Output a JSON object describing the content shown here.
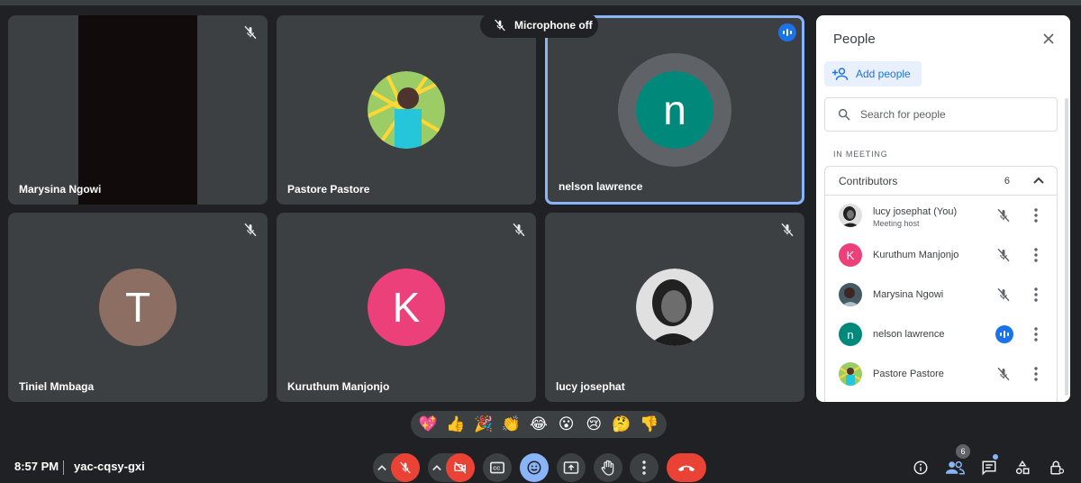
{
  "toast": {
    "text": "Microphone off"
  },
  "tiles": [
    {
      "name": "Marysina Ngowi",
      "type": "video"
    },
    {
      "name": "Pastore Pastore",
      "type": "photo"
    },
    {
      "name": "nelson lawrence",
      "type": "letter",
      "letter": "n",
      "color": "#00897b",
      "speaking": true
    },
    {
      "name": "Tiniel Mmbaga",
      "type": "letter",
      "letter": "T",
      "color": "#8d6e63"
    },
    {
      "name": "Kuruthum Manjonjo",
      "type": "letter",
      "letter": "K",
      "color": "#ec407a"
    },
    {
      "name": "lucy josephat",
      "type": "photo"
    }
  ],
  "panel": {
    "title": "People",
    "add_people": "Add people",
    "search_placeholder": "Search for people",
    "section": "IN MEETING",
    "group_label": "Contributors",
    "group_count": "6",
    "people": [
      {
        "name": "lucy josephat (You)",
        "sub": "Meeting host",
        "avatar": "photo",
        "mic": "off"
      },
      {
        "name": "Kuruthum Manjonjo",
        "avatar": "K",
        "color": "#ec407a",
        "mic": "off"
      },
      {
        "name": "Marysina Ngowi",
        "avatar": "photo",
        "mic": "off"
      },
      {
        "name": "nelson lawrence",
        "avatar": "n",
        "color": "#00897b",
        "mic": "speaking"
      },
      {
        "name": "Pastore Pastore",
        "avatar": "photo",
        "mic": "off"
      }
    ]
  },
  "reactions": [
    "💖",
    "👍",
    "🎉",
    "👏",
    "😂",
    "😮",
    "😢",
    "🤔",
    "👎"
  ],
  "bottom": {
    "time": "8:57 PM",
    "meeting_code": "yac-cqsy-gxi",
    "people_count": "6"
  },
  "colors": {
    "accent": "#8ab4f8",
    "danger": "#ea4335",
    "speaking": "#1a73e8"
  }
}
